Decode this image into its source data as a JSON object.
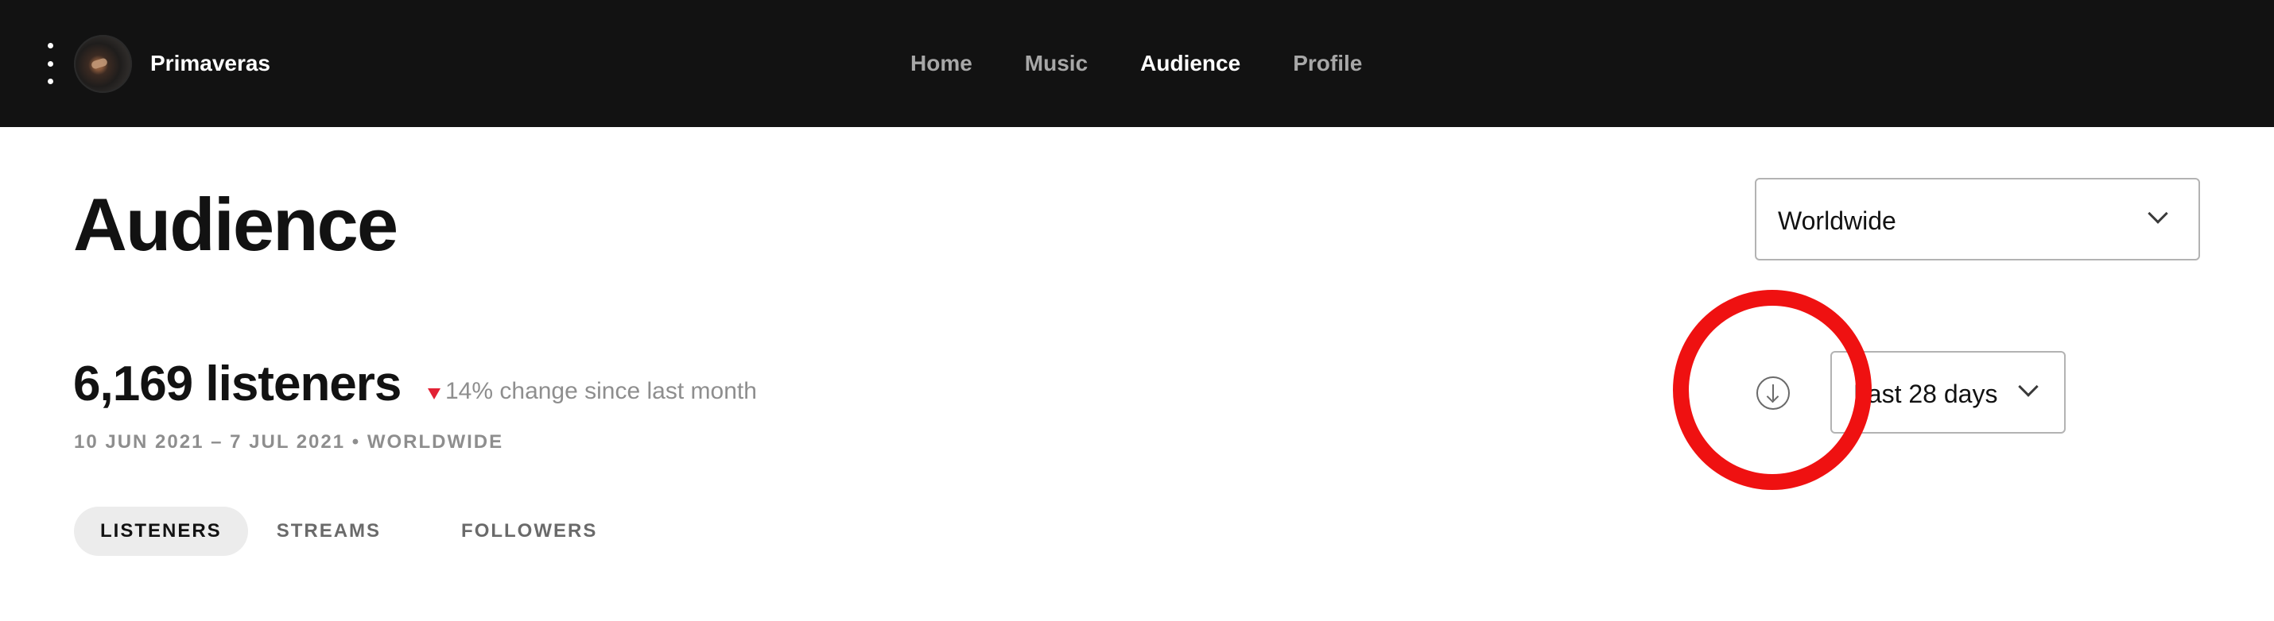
{
  "header": {
    "artist_name": "Primaveras",
    "nav": [
      {
        "label": "Home",
        "active": false
      },
      {
        "label": "Music",
        "active": false
      },
      {
        "label": "Audience",
        "active": true
      },
      {
        "label": "Profile",
        "active": false
      }
    ]
  },
  "page": {
    "title": "Audience",
    "region_select": {
      "value": "Worldwide"
    },
    "stats": {
      "count": "6,169 listeners",
      "change": "14% change since last month",
      "change_direction": "down",
      "range": "10 JUN 2021 – 7 JUL 2021 • WORLDWIDE"
    },
    "period_select": {
      "value": "Last 28 days"
    },
    "tabs": [
      {
        "label": "LISTENERS",
        "active": true
      },
      {
        "label": "STREAMS",
        "active": false
      },
      {
        "label": "FOLLOWERS",
        "active": false
      }
    ]
  },
  "colors": {
    "header_bg": "#121212",
    "negative_change": "#e22134",
    "annotation_ring": "#ef1111"
  },
  "icons": [
    "more-vertical-icon",
    "chevron-down-icon",
    "download-icon",
    "down-triangle-icon"
  ]
}
